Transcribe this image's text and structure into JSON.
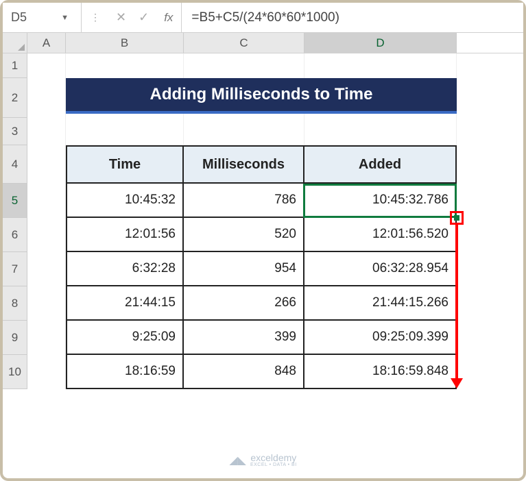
{
  "name_box": "D5",
  "formula": "=B5+C5/(24*60*60*1000)",
  "fx_label": "fx",
  "columns": [
    "A",
    "B",
    "C",
    "D"
  ],
  "rows": [
    "1",
    "2",
    "3",
    "4",
    "5",
    "6",
    "7",
    "8",
    "9",
    "10"
  ],
  "title": "Adding Milliseconds to Time",
  "headers": {
    "time": "Time",
    "ms": "Milliseconds",
    "added": "Added"
  },
  "chart_data": {
    "type": "table",
    "columns": [
      "Time",
      "Milliseconds",
      "Added"
    ],
    "rows": [
      {
        "time": "10:45:32",
        "ms": "786",
        "added": "10:45:32.786"
      },
      {
        "time": "12:01:56",
        "ms": "520",
        "added": "12:01:56.520"
      },
      {
        "time": "6:32:28",
        "ms": "954",
        "added": "06:32:28.954"
      },
      {
        "time": "21:44:15",
        "ms": "266",
        "added": "21:44:15.266"
      },
      {
        "time": "9:25:09",
        "ms": "399",
        "added": "09:25:09.399"
      },
      {
        "time": "18:16:59",
        "ms": "848",
        "added": "18:16:59.848"
      }
    ]
  },
  "watermark": {
    "brand": "exceldemy",
    "tag": "EXCEL • DATA • BI"
  }
}
